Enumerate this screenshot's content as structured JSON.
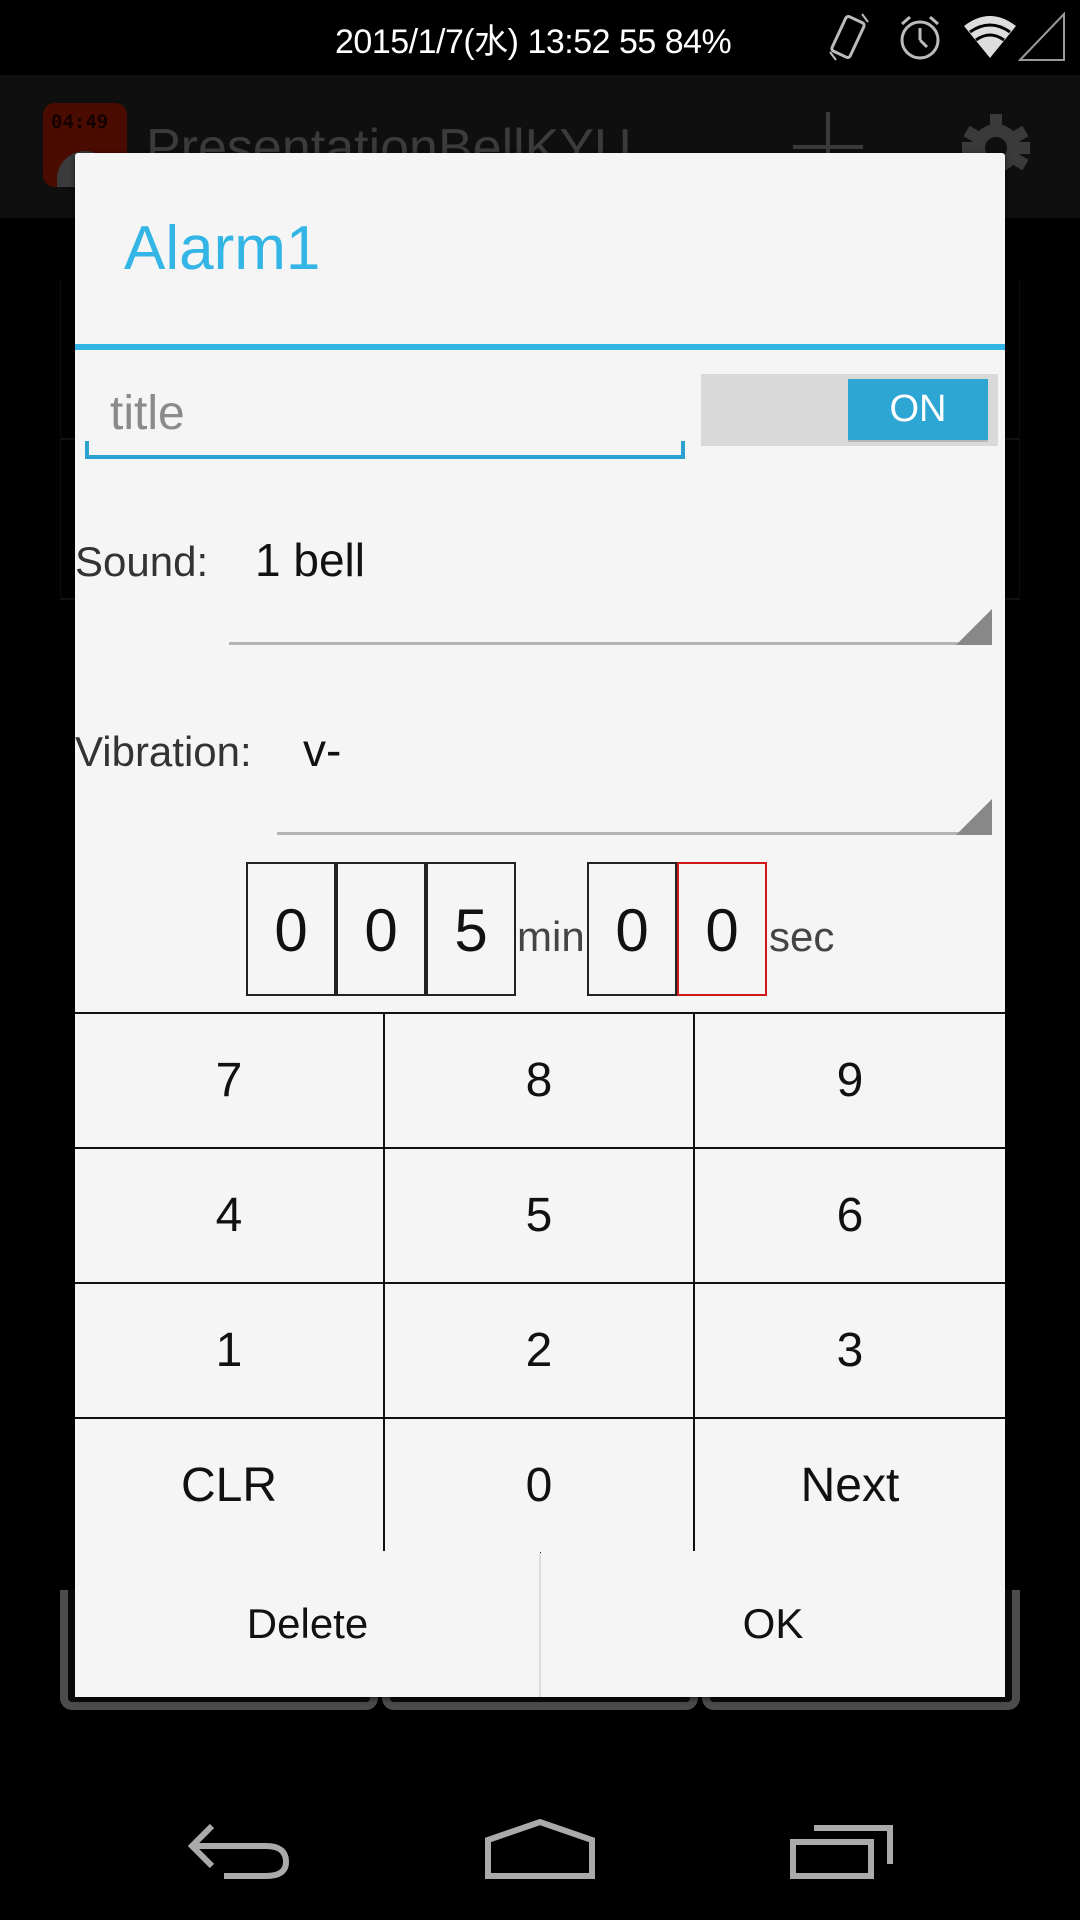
{
  "status_bar": {
    "text": "2015/1/7(水) 13:52 55 84%",
    "icons": [
      "vibrate-icon",
      "alarm-icon",
      "wifi-icon",
      "signal-icon"
    ]
  },
  "action_bar": {
    "app_title": "PresentationBellKYU",
    "app_icon_clock": "04:49",
    "actions": [
      "add-icon",
      "settings-gear-icon"
    ]
  },
  "dialog": {
    "title": "Alarm1",
    "accent_color": "#33b5e5",
    "title_input": {
      "value": "",
      "placeholder": "title"
    },
    "toggle": {
      "label": "ON",
      "state": "on"
    },
    "sound": {
      "label": "Sound:",
      "value": "1 bell"
    },
    "vibration": {
      "label": "Vibration:",
      "value": "v-"
    },
    "time": {
      "min_digits": [
        "0",
        "0",
        "5"
      ],
      "min_label": "min",
      "sec_digits": [
        "0",
        "0"
      ],
      "sec_label": "sec",
      "active_digit": "sec-2",
      "active_color": "#d01818"
    },
    "keypad": {
      "keys": [
        "7",
        "8",
        "9",
        "4",
        "5",
        "6",
        "1",
        "2",
        "3",
        "CLR",
        "0",
        "Next"
      ]
    },
    "buttons": {
      "delete": "Delete",
      "ok": "OK"
    }
  },
  "nav_bar": {
    "icons": [
      "back-icon",
      "home-icon",
      "recents-icon"
    ]
  }
}
